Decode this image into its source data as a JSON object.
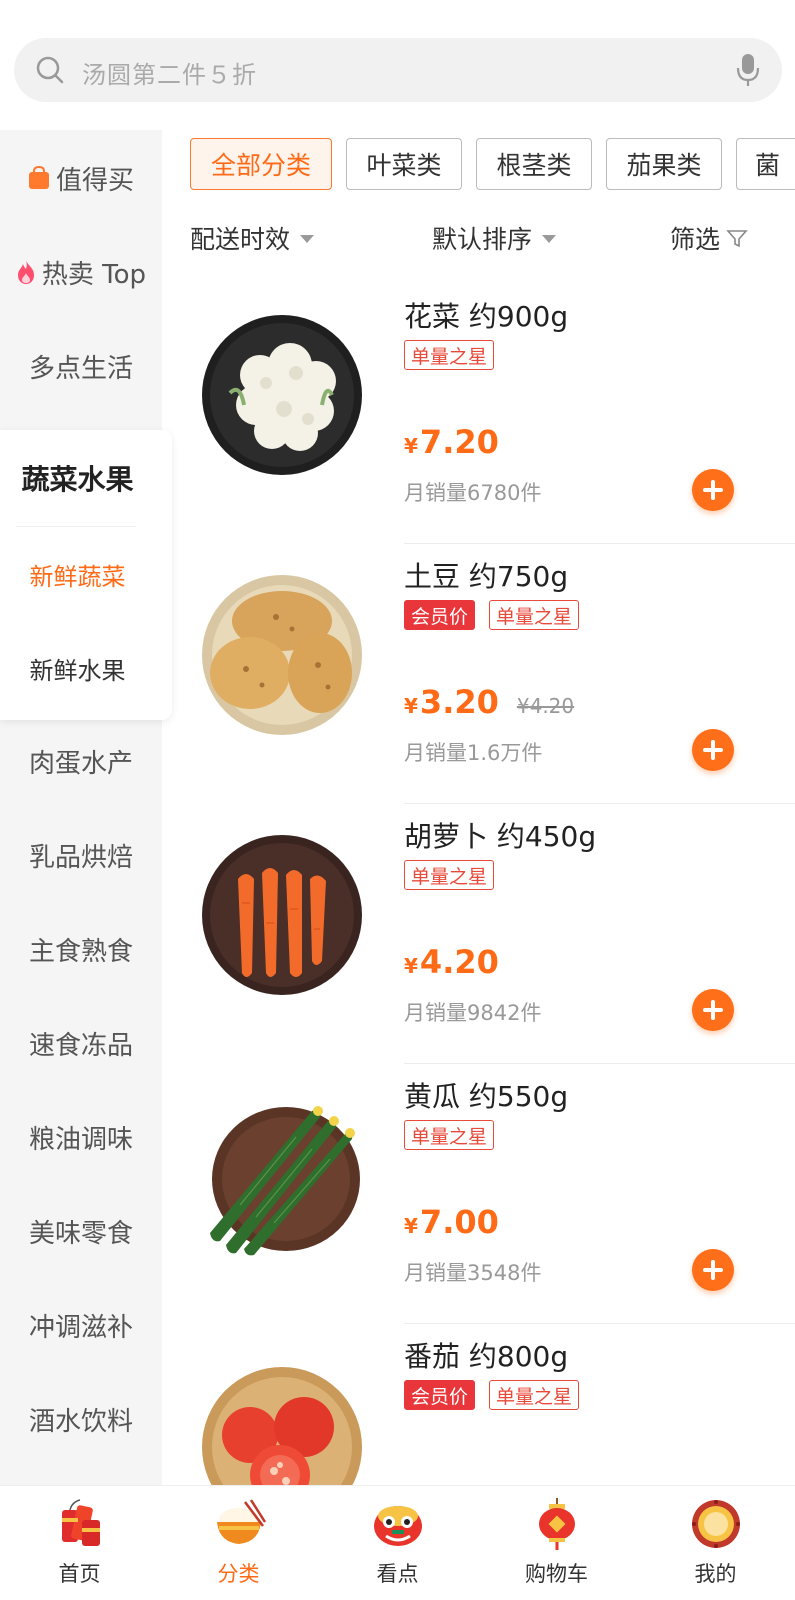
{
  "search": {
    "placeholder": "汤圆第二件５折",
    "icon": "search-icon",
    "mic_icon": "microphone-icon"
  },
  "sidebar": {
    "top_items": [
      {
        "label": "值得买",
        "icon": "shopping-bag-icon",
        "icon_color": "#ff7a2d"
      },
      {
        "label": "热卖 Top",
        "icon": "fire-icon",
        "icon_color": "#ff4d6d"
      },
      {
        "label": "多点生活"
      }
    ],
    "selected_group": {
      "label": "蔬菜水果",
      "subs": [
        {
          "label": "新鲜蔬菜",
          "active": true
        },
        {
          "label": "新鲜水果",
          "active": false
        }
      ]
    },
    "bottom_items": [
      {
        "label": "肉蛋水产"
      },
      {
        "label": "乳品烘焙"
      },
      {
        "label": "主食熟食"
      },
      {
        "label": "速食冻品"
      },
      {
        "label": "粮油调味"
      },
      {
        "label": "美味零食"
      },
      {
        "label": "冲调滋补"
      },
      {
        "label": "酒水饮料"
      }
    ]
  },
  "chips": [
    {
      "label": "全部分类",
      "active": true
    },
    {
      "label": "叶菜类",
      "active": false
    },
    {
      "label": "根茎类",
      "active": false
    },
    {
      "label": "茄果类",
      "active": false
    },
    {
      "label": "菌",
      "active": false
    }
  ],
  "sort": {
    "delivery": "配送时效",
    "default_sort": "默认排序",
    "filter": "筛选",
    "filter_icon": "funnel-icon"
  },
  "products": [
    {
      "name": "花菜 约900g",
      "tags": [
        {
          "label": "单量之星",
          "solid": false
        }
      ],
      "price": "7.20",
      "orig_price": "",
      "sales": "月销量6780件",
      "image": "cauliflower"
    },
    {
      "name": "土豆 约750g",
      "tags": [
        {
          "label": "会员价",
          "solid": true
        },
        {
          "label": "单量之星",
          "solid": false
        }
      ],
      "price": "3.20",
      "orig_price": "¥4.20",
      "sales": "月销量1.6万件",
      "image": "potato"
    },
    {
      "name": "胡萝卜 约450g",
      "tags": [
        {
          "label": "单量之星",
          "solid": false
        }
      ],
      "price": "4.20",
      "orig_price": "",
      "sales": "月销量9842件",
      "image": "carrot"
    },
    {
      "name": "黄瓜 约550g",
      "tags": [
        {
          "label": "单量之星",
          "solid": false
        }
      ],
      "price": "7.00",
      "orig_price": "",
      "sales": "月销量3548件",
      "image": "cucumber"
    },
    {
      "name": "番茄 约800g",
      "tags": [
        {
          "label": "会员价",
          "solid": true
        },
        {
          "label": "单量之星",
          "solid": false
        }
      ],
      "price": "",
      "orig_price": "",
      "sales": "",
      "image": "tomato"
    }
  ],
  "currency_symbol": "¥",
  "tabbar": [
    {
      "label": "首页",
      "icon": "firecracker-icon",
      "active": false
    },
    {
      "label": "分类",
      "icon": "rice-bowl-icon",
      "active": true
    },
    {
      "label": "看点",
      "icon": "lion-dance-icon",
      "active": false
    },
    {
      "label": "购物车",
      "icon": "lantern-icon",
      "active": false
    },
    {
      "label": "我的",
      "icon": "drum-icon",
      "active": false
    }
  ],
  "colors": {
    "accent": "#ff6a16",
    "tag_red": "#e8363a"
  }
}
